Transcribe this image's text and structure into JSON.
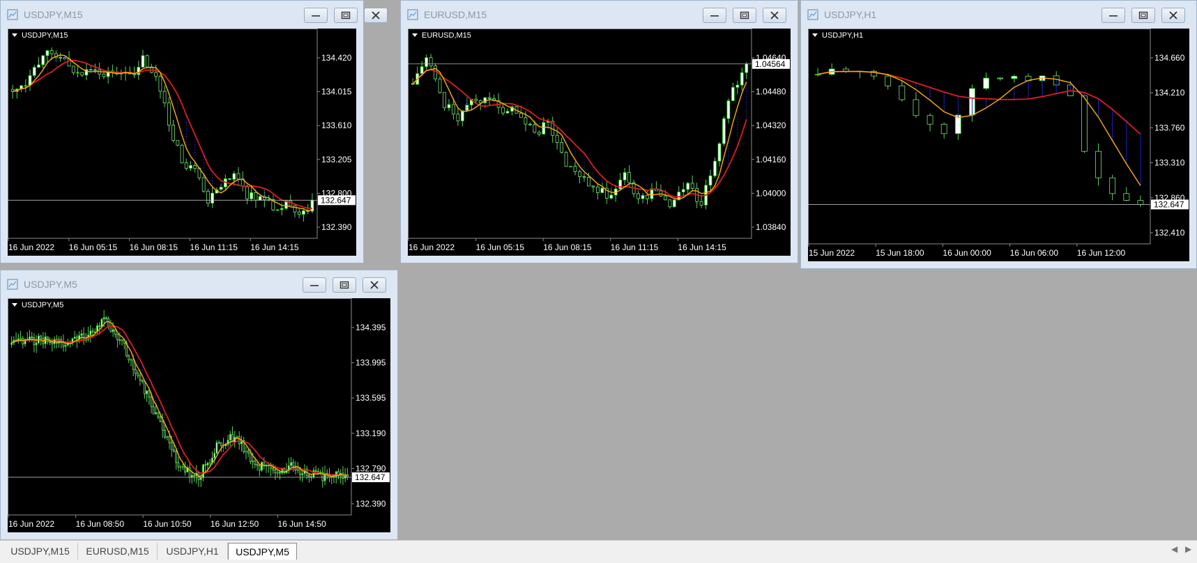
{
  "colors": {
    "bull": "#ffffff",
    "bull_border": "#00d200",
    "bear": "#000000",
    "bear_border": "#7be37b",
    "wick": "#5bd45b",
    "ma_slow": "#dd1f1f",
    "ma_fast": "#ffb000",
    "fill": "#2020c8",
    "axis_text": "#ffffff",
    "price_line": "#b8b8b8"
  },
  "windows": [
    {
      "title": "USDJPY,M15",
      "symbol_label": "USDJPY,M15",
      "price_ticks": [
        "134.420",
        "134.015",
        "133.610",
        "133.205",
        "132.800",
        "132.390"
      ],
      "current_price": "132.647",
      "time_ticks": [
        "16 Jun 2022",
        "16 Jun 05:15",
        "16 Jun 08:15",
        "16 Jun 11:15",
        "16 Jun 14:15"
      ]
    },
    {
      "title": "EURUSD,M15",
      "symbol_label": "EURUSD,M15",
      "price_ticks": [
        "1.04640",
        "1.04480",
        "1.04320",
        "1.04160",
        "1.04000",
        "1.03840"
      ],
      "current_price": "1.04564",
      "time_ticks": [
        "16 Jun 2022",
        "16 Jun 05:15",
        "16 Jun 08:15",
        "16 Jun 11:15",
        "16 Jun 14:15"
      ]
    },
    {
      "title": "USDJPY,H1",
      "symbol_label": "USDJPY,H1",
      "price_ticks": [
        "134.660",
        "134.210",
        "133.760",
        "133.310",
        "132.860",
        "132.410"
      ],
      "current_price": "132.647",
      "time_ticks": [
        "15 Jun 2022",
        "15 Jun 18:00",
        "16 Jun 00:00",
        "16 Jun 06:00",
        "16 Jun 12:00"
      ]
    },
    {
      "title": "USDJPY,M5",
      "symbol_label": "USDJPY,M5",
      "price_ticks": [
        "134.395",
        "133.995",
        "133.595",
        "133.190",
        "132.790",
        "132.390"
      ],
      "current_price": "132.647",
      "time_ticks": [
        "16 Jun 2022",
        "16 Jun 08:50",
        "16 Jun 10:50",
        "16 Jun 12:50",
        "16 Jun 14:50"
      ]
    }
  ],
  "tabs": [
    {
      "label": "USDJPY,M15",
      "active": false
    },
    {
      "label": "EURUSD,M15",
      "active": false
    },
    {
      "label": "USDJPY,H1",
      "active": false
    },
    {
      "label": "USDJPY,M5",
      "active": true
    }
  ]
}
